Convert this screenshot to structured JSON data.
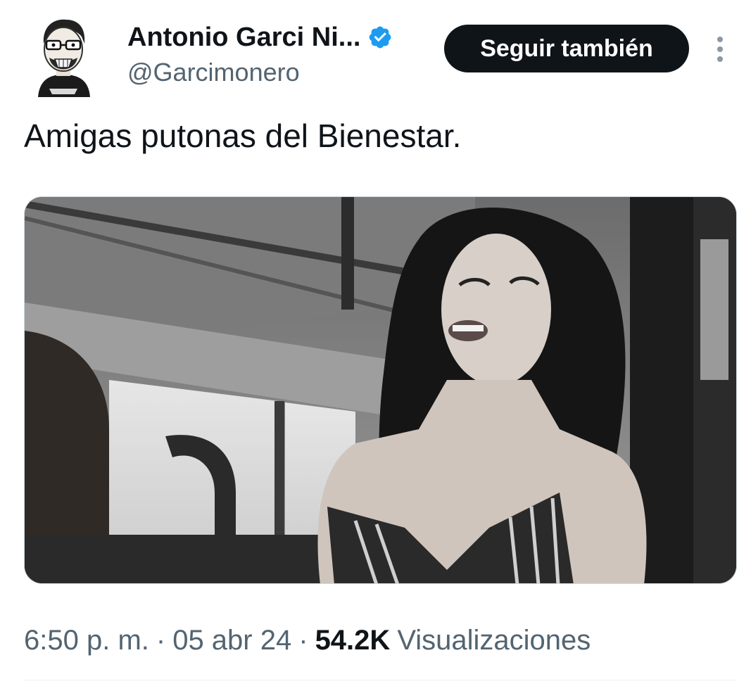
{
  "author": {
    "display_name": "Antonio Garci Ni...",
    "handle": "@Garcimonero",
    "verified": true,
    "verified_color": "#1d9bf0"
  },
  "actions": {
    "follow_label": "Seguir también",
    "more_icon": "more-vertical-icon"
  },
  "tweet": {
    "text": "Amigas putonas del Bienestar."
  },
  "meta": {
    "time": "6:50 p. m.",
    "separator": "·",
    "date": "05 abr 24",
    "views_count": "54.2K",
    "views_label": "Visualizaciones"
  },
  "colors": {
    "primary_text": "#0f1419",
    "secondary_text": "#536471",
    "button_bg": "#0f1419",
    "button_text": "#ffffff"
  }
}
